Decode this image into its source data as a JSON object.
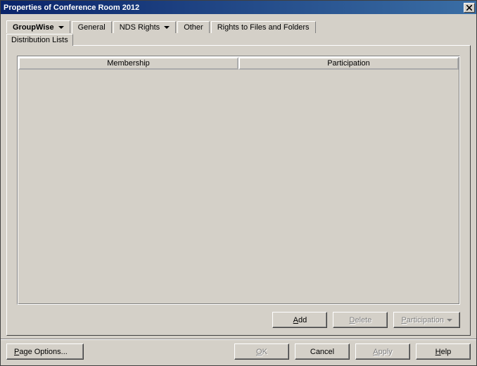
{
  "titlebar": {
    "title": "Properties of Conference Room 2012"
  },
  "tabs": {
    "groupwise": "GroupWise",
    "general": "General",
    "nds_rights": "NDS Rights",
    "other": "Other",
    "rights_files": "Rights to Files and Folders"
  },
  "subtab": {
    "distribution_lists": "Distribution Lists"
  },
  "grid": {
    "col_membership": "Membership",
    "col_participation": "Participation"
  },
  "buttons": {
    "add": "dd",
    "add_prefix": "A",
    "delete": "elete",
    "delete_prefix": "D",
    "participation": "articipation",
    "participation_prefix": "P"
  },
  "footer": {
    "page_options_prefix": "P",
    "page_options": "age Options...",
    "ok_prefix": "O",
    "ok": "K",
    "cancel": "Cancel",
    "apply_prefix": "A",
    "apply": "pply",
    "help_prefix": "H",
    "help": "elp"
  }
}
